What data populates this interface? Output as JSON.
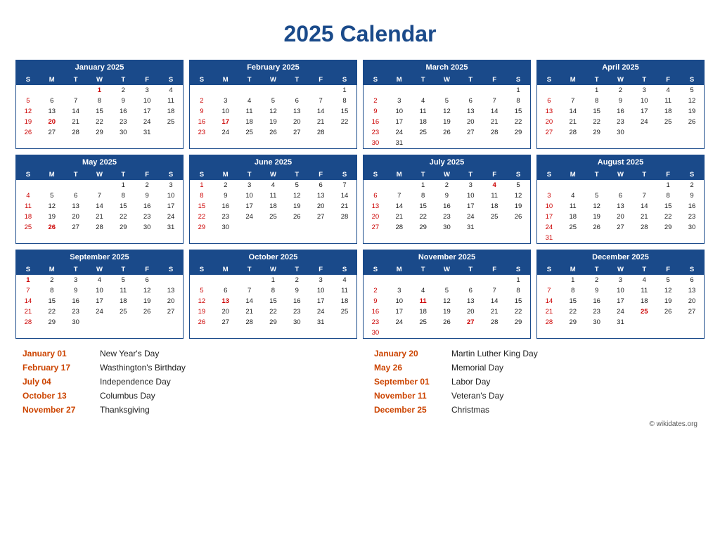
{
  "title": "2025 Calendar",
  "copyright": "© wikidates.org",
  "months": [
    {
      "name": "January 2025",
      "days_header": [
        "S",
        "M",
        "T",
        "W",
        "T",
        "F",
        "S"
      ],
      "weeks": [
        [
          null,
          null,
          null,
          "1",
          "2",
          "3",
          "4"
        ],
        [
          "5",
          "6",
          "7",
          "8",
          "9",
          "10",
          "11"
        ],
        [
          "12",
          "13",
          "14",
          "15",
          "16",
          "17",
          "18"
        ],
        [
          "19",
          "20",
          "21",
          "22",
          "23",
          "24",
          "25"
        ],
        [
          "26",
          "27",
          "28",
          "29",
          "30",
          "31",
          null
        ]
      ],
      "holidays": [
        "1",
        "20"
      ],
      "red_sundays": []
    },
    {
      "name": "February 2025",
      "days_header": [
        "S",
        "M",
        "T",
        "W",
        "T",
        "F",
        "S"
      ],
      "weeks": [
        [
          null,
          null,
          null,
          null,
          null,
          null,
          "1"
        ],
        [
          "2",
          "3",
          "4",
          "5",
          "6",
          "7",
          "8"
        ],
        [
          "9",
          "10",
          "11",
          "12",
          "13",
          "14",
          "15"
        ],
        [
          "16",
          "17",
          "18",
          "19",
          "20",
          "21",
          "22"
        ],
        [
          "23",
          "24",
          "25",
          "26",
          "27",
          "28",
          null
        ]
      ],
      "holidays": [
        "17"
      ],
      "red_sundays": []
    },
    {
      "name": "March 2025",
      "days_header": [
        "S",
        "M",
        "T",
        "W",
        "T",
        "F",
        "S"
      ],
      "weeks": [
        [
          null,
          null,
          null,
          null,
          null,
          null,
          "1"
        ],
        [
          "2",
          "3",
          "4",
          "5",
          "6",
          "7",
          "8"
        ],
        [
          "9",
          "10",
          "11",
          "12",
          "13",
          "14",
          "15"
        ],
        [
          "16",
          "17",
          "18",
          "19",
          "20",
          "21",
          "22"
        ],
        [
          "23",
          "24",
          "25",
          "26",
          "27",
          "28",
          "29"
        ],
        [
          "30",
          "31",
          null,
          null,
          null,
          null,
          null
        ]
      ],
      "holidays": [],
      "red_sundays": []
    },
    {
      "name": "April 2025",
      "days_header": [
        "S",
        "M",
        "T",
        "W",
        "T",
        "F",
        "S"
      ],
      "weeks": [
        [
          null,
          null,
          "1",
          "2",
          "3",
          "4",
          "5"
        ],
        [
          "6",
          "7",
          "8",
          "9",
          "10",
          "11",
          "12"
        ],
        [
          "13",
          "14",
          "15",
          "16",
          "17",
          "18",
          "19"
        ],
        [
          "20",
          "21",
          "22",
          "23",
          "24",
          "25",
          "26"
        ],
        [
          "27",
          "28",
          "29",
          "30",
          null,
          null,
          null
        ]
      ],
      "holidays": [],
      "red_sundays": []
    },
    {
      "name": "May 2025",
      "days_header": [
        "S",
        "M",
        "T",
        "W",
        "T",
        "F",
        "S"
      ],
      "weeks": [
        [
          null,
          null,
          null,
          null,
          "1",
          "2",
          "3"
        ],
        [
          "4",
          "5",
          "6",
          "7",
          "8",
          "9",
          "10"
        ],
        [
          "11",
          "12",
          "13",
          "14",
          "15",
          "16",
          "17"
        ],
        [
          "18",
          "19",
          "20",
          "21",
          "22",
          "23",
          "24"
        ],
        [
          "25",
          "26",
          "27",
          "28",
          "29",
          "30",
          "31"
        ]
      ],
      "holidays": [
        "26"
      ],
      "red_sundays": []
    },
    {
      "name": "June 2025",
      "days_header": [
        "S",
        "M",
        "T",
        "W",
        "T",
        "F",
        "S"
      ],
      "weeks": [
        [
          "1",
          "2",
          "3",
          "4",
          "5",
          "6",
          "7"
        ],
        [
          "8",
          "9",
          "10",
          "11",
          "12",
          "13",
          "14"
        ],
        [
          "15",
          "16",
          "17",
          "18",
          "19",
          "20",
          "21"
        ],
        [
          "22",
          "23",
          "24",
          "25",
          "26",
          "27",
          "28"
        ],
        [
          "29",
          "30",
          null,
          null,
          null,
          null,
          null
        ]
      ],
      "holidays": [],
      "red_sundays": []
    },
    {
      "name": "July 2025",
      "days_header": [
        "S",
        "M",
        "T",
        "W",
        "T",
        "F",
        "S"
      ],
      "weeks": [
        [
          null,
          null,
          "1",
          "2",
          "3",
          "4",
          "5"
        ],
        [
          "6",
          "7",
          "8",
          "9",
          "10",
          "11",
          "12"
        ],
        [
          "13",
          "14",
          "15",
          "16",
          "17",
          "18",
          "19"
        ],
        [
          "20",
          "21",
          "22",
          "23",
          "24",
          "25",
          "26"
        ],
        [
          "27",
          "28",
          "29",
          "30",
          "31",
          null,
          null
        ]
      ],
      "holidays": [
        "4"
      ],
      "red_sundays": []
    },
    {
      "name": "August 2025",
      "days_header": [
        "S",
        "M",
        "T",
        "W",
        "T",
        "F",
        "S"
      ],
      "weeks": [
        [
          null,
          null,
          null,
          null,
          null,
          "1",
          "2"
        ],
        [
          "3",
          "4",
          "5",
          "6",
          "7",
          "8",
          "9"
        ],
        [
          "10",
          "11",
          "12",
          "13",
          "14",
          "15",
          "16"
        ],
        [
          "17",
          "18",
          "19",
          "20",
          "21",
          "22",
          "23"
        ],
        [
          "24",
          "25",
          "26",
          "27",
          "28",
          "29",
          "30"
        ],
        [
          "31",
          null,
          null,
          null,
          null,
          null,
          null
        ]
      ],
      "holidays": [],
      "red_sundays": []
    },
    {
      "name": "September 2025",
      "days_header": [
        "S",
        "M",
        "T",
        "W",
        "T",
        "F",
        "S"
      ],
      "weeks": [
        [
          "1",
          "2",
          "3",
          "4",
          "5",
          "6",
          null
        ],
        [
          "7",
          "8",
          "9",
          "10",
          "11",
          "12",
          "13"
        ],
        [
          "14",
          "15",
          "16",
          "17",
          "18",
          "19",
          "20"
        ],
        [
          "21",
          "22",
          "23",
          "24",
          "25",
          "26",
          "27"
        ],
        [
          "28",
          "29",
          "30",
          null,
          null,
          null,
          null
        ]
      ],
      "holidays": [
        "1"
      ],
      "red_sundays": []
    },
    {
      "name": "October 2025",
      "days_header": [
        "S",
        "M",
        "T",
        "W",
        "T",
        "F",
        "S"
      ],
      "weeks": [
        [
          null,
          null,
          null,
          "1",
          "2",
          "3",
          "4"
        ],
        [
          "5",
          "6",
          "7",
          "8",
          "9",
          "10",
          "11"
        ],
        [
          "12",
          "13",
          "14",
          "15",
          "16",
          "17",
          "18"
        ],
        [
          "19",
          "20",
          "21",
          "22",
          "23",
          "24",
          "25"
        ],
        [
          "26",
          "27",
          "28",
          "29",
          "30",
          "31",
          null
        ]
      ],
      "holidays": [
        "13"
      ],
      "red_sundays": []
    },
    {
      "name": "November 2025",
      "days_header": [
        "S",
        "M",
        "T",
        "W",
        "T",
        "F",
        "S"
      ],
      "weeks": [
        [
          null,
          null,
          null,
          null,
          null,
          null,
          "1"
        ],
        [
          "2",
          "3",
          "4",
          "5",
          "6",
          "7",
          "8"
        ],
        [
          "9",
          "10",
          "11",
          "12",
          "13",
          "14",
          "15"
        ],
        [
          "16",
          "17",
          "18",
          "19",
          "20",
          "21",
          "22"
        ],
        [
          "23",
          "24",
          "25",
          "26",
          "27",
          "28",
          "29"
        ],
        [
          "30",
          null,
          null,
          null,
          null,
          null,
          null
        ]
      ],
      "holidays": [
        "11",
        "27"
      ],
      "red_sundays": []
    },
    {
      "name": "December 2025",
      "days_header": [
        "S",
        "M",
        "T",
        "W",
        "T",
        "F",
        "S"
      ],
      "weeks": [
        [
          null,
          "1",
          "2",
          "3",
          "4",
          "5",
          "6"
        ],
        [
          "7",
          "8",
          "9",
          "10",
          "11",
          "12",
          "13"
        ],
        [
          "14",
          "15",
          "16",
          "17",
          "18",
          "19",
          "20"
        ],
        [
          "21",
          "22",
          "23",
          "24",
          "25",
          "26",
          "27"
        ],
        [
          "28",
          "29",
          "30",
          "31",
          null,
          null,
          null
        ]
      ],
      "holidays": [
        "25"
      ],
      "red_sundays": []
    }
  ],
  "holidays_list": [
    {
      "date": "January 01",
      "name": "New Year's Day"
    },
    {
      "date": "January 20",
      "name": "Martin Luther King Day"
    },
    {
      "date": "February 17",
      "name": "Wasthington's Birthday"
    },
    {
      "date": "May 26",
      "name": "Memorial Day"
    },
    {
      "date": "July 04",
      "name": "Independence Day"
    },
    {
      "date": "September 01",
      "name": "Labor Day"
    },
    {
      "date": "October 13",
      "name": "Columbus Day"
    },
    {
      "date": "November 11",
      "name": "Veteran's Day"
    },
    {
      "date": "November 27",
      "name": "Thanksgiving"
    },
    {
      "date": "December 25",
      "name": "Christmas"
    }
  ],
  "special_days": {
    "jan20": "20",
    "feb17": "17",
    "may26": "26",
    "jul4": "4",
    "sep1": "1",
    "oct13": "13",
    "nov11": "11",
    "nov27": "27",
    "dec25": "25"
  }
}
